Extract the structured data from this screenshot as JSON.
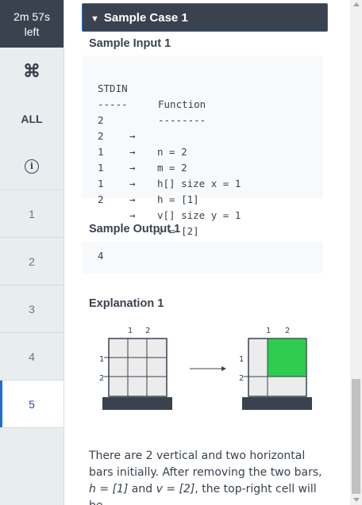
{
  "sidebar": {
    "timer_line1": "2m 57s",
    "timer_line2": "left",
    "cmd_glyph": "⌘",
    "all_label": "ALL",
    "info_glyph": "i",
    "questions": [
      "1",
      "2",
      "3",
      "4",
      "5"
    ],
    "active_question": "5"
  },
  "sample": {
    "header": "Sample Case 1",
    "input_title": "Sample Input 1",
    "stdin_header": "STDIN",
    "function_header": "Function",
    "stdin_rule": "-----",
    "function_rule": "--------",
    "rows": [
      {
        "stdin": "2",
        "arrow": "→",
        "func": "n = 2"
      },
      {
        "stdin": "2",
        "arrow": "→",
        "func": "m = 2"
      },
      {
        "stdin": "1",
        "arrow": "→",
        "func": "h[] size x = 1"
      },
      {
        "stdin": "1",
        "arrow": "→",
        "func": "h = [1]"
      },
      {
        "stdin": "1",
        "arrow": "→",
        "func": "v[] size y = 1"
      },
      {
        "stdin": "2",
        "arrow": "→",
        "func": "v = [2]"
      }
    ],
    "output_title": "Sample Output 1",
    "output_value": "4",
    "explanation_title": "Explanation 1",
    "diagram": {
      "col_labels": [
        "1",
        "2"
      ],
      "row_labels": [
        "1",
        "2"
      ],
      "highlight_color": "#2ecc4f",
      "base_color": "#39424e"
    },
    "para_p1": "There are 2 vertical and two horizontal bars initially. After removing the two bars,",
    "para_h": "h = [1]",
    "para_and": " and ",
    "para_v": "v = [2]",
    "para_p2": ", the top-right cell will be"
  }
}
